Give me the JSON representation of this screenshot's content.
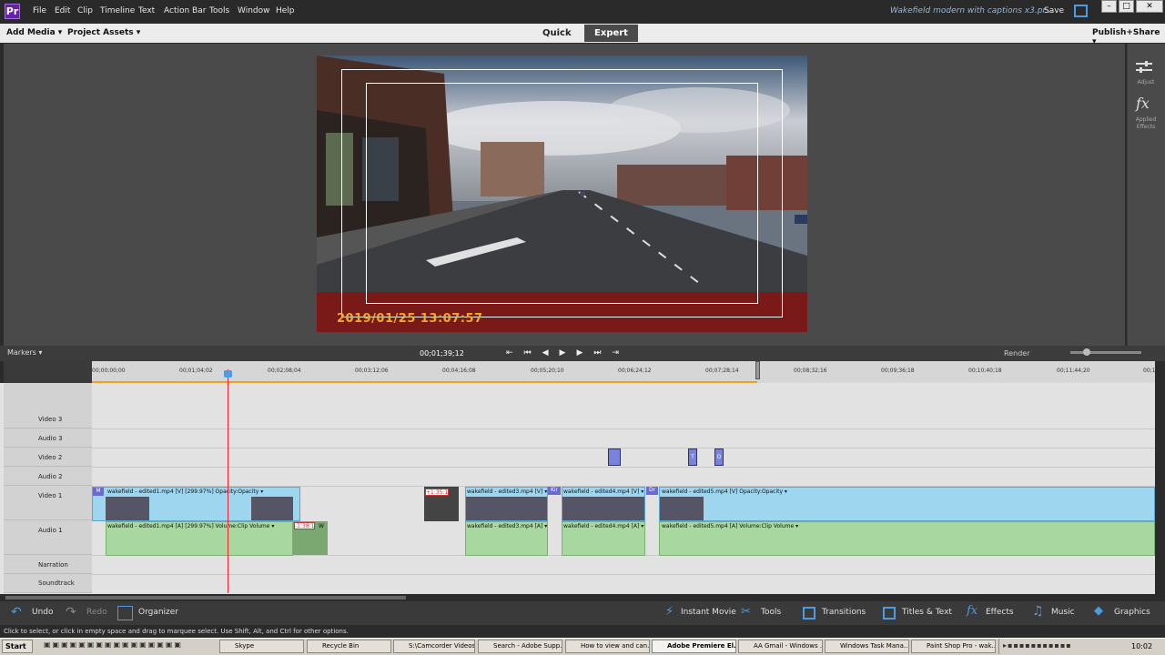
{
  "app": {
    "logo": "Pr",
    "title": "Wakefield modern with captions x3.pr...",
    "save": "Save"
  },
  "menu": [
    "File",
    "Edit",
    "Clip",
    "Timeline",
    "Text",
    "Action Bar",
    "Tools",
    "Window",
    "Help"
  ],
  "modebar": {
    "add_media": "Add Media ▾",
    "project_assets": "Project Assets ▾",
    "quick": "Quick",
    "expert": "Expert",
    "publish": "Publish+Share ▾"
  },
  "right_panel": {
    "adjust": "Adjust",
    "applied_effects_1": "Applied",
    "applied_effects_2": "Effects"
  },
  "monitor": {
    "datestamp": "2019/01/25 13:07:57"
  },
  "timeline_header": {
    "markers": "Markers ▾",
    "timecode": "00;01;39;12",
    "render": "Render"
  },
  "ruler": [
    "00;00;00;00",
    "00;01;04;02",
    "00;02;08;04",
    "00;03;12;06",
    "00;04;16;08",
    "00;05;20;10",
    "00;06;24;12",
    "00;07;28;14",
    "00;08;32;16",
    "00;09;36;18",
    "00;10;40;18",
    "00;11;44;20",
    "00;1"
  ],
  "tracks": [
    "Video 3",
    "Audio 3",
    "Video 2",
    "Audio 2",
    "Video 1",
    "Audio 1",
    "Narration",
    "Soundtrack"
  ],
  "clips": {
    "v1a": "wakefield - edited1.mp4 [V] [299.97%]   Opacity:Opacity ▾",
    "a1a": "wakefield - edited1.mp4 [A] [299.97%]   Volume:Clip Volume ▾",
    "v1b": "wakefield - edited3.mp4 [V] ▾",
    "a1b": "wakefield - edited3.mp4 [A] ▾",
    "v1c": "wakefield - edited4.mp4 [V] ▾",
    "a1c": "wakefield - edited4.mp4 [A] ▾",
    "v1d": "wakefield - edited5.mp4 [V]   Opacity:Opacity ▾",
    "a1d": "wakefield - edited5.mp4 [A]   Volume:Clip Volume ▾",
    "gap1": "+1:35:1",
    "gap2": "-1:38:1",
    "m": "M",
    "kir": "Kir",
    "dr": "Dr",
    "w": "W",
    "t1": "T",
    "t2": "O"
  },
  "bottombar": {
    "undo": "Undo",
    "redo": "Redo",
    "organizer": "Organizer",
    "instant_movie": "Instant Movie",
    "tools": "Tools",
    "transitions": "Transitions",
    "titles": "Titles & Text",
    "effects": "Effects",
    "music": "Music",
    "graphics": "Graphics"
  },
  "status": "Click to select, or click in empty space and drag to marquee select. Use Shift, Alt, and Ctrl for other options.",
  "taskbar": {
    "start": "Start",
    "items": [
      "Skype",
      "Recycle Bin",
      "S:\\Camcorder Videos...",
      "Search - Adobe Supp...",
      "How to view and can...",
      "Adobe Premiere El...",
      "AA Gmail - Windows ...",
      "Windows Task Mana...",
      "Paint Shop Pro - wak..."
    ],
    "clock": "10:02"
  }
}
